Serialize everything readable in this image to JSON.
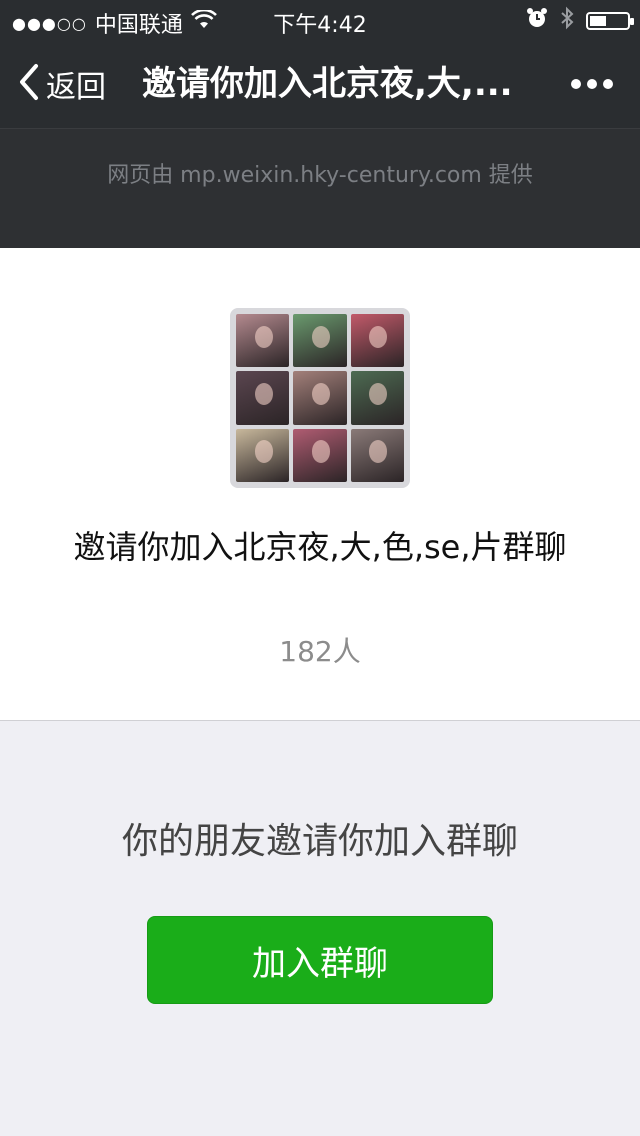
{
  "status_bar": {
    "signal_dots": "●●●○○",
    "carrier": "中国联通",
    "time": "下午4:42",
    "battery_level": 0.45
  },
  "nav": {
    "back_label": "返回",
    "title": "邀请你加入北京夜,大,..."
  },
  "banner": {
    "provider_text": "网页由 mp.weixin.hky-century.com 提供"
  },
  "group": {
    "name": "邀请你加入北京夜,大,色,se,片群聊",
    "member_count": "182人",
    "avatar_colors": [
      "#b48a8f",
      "#6a9a6e",
      "#c25a6a",
      "#5b4650",
      "#a3807a",
      "#4d6b52",
      "#c8b89c",
      "#b05c72",
      "#8a7a78"
    ]
  },
  "invite": {
    "text": "你的朋友邀请你加入群聊",
    "button_label": "加入群聊"
  },
  "colors": {
    "nav_bg": "#2a2d30",
    "accent_green": "#1aad19",
    "page_bg": "#efeff4"
  }
}
